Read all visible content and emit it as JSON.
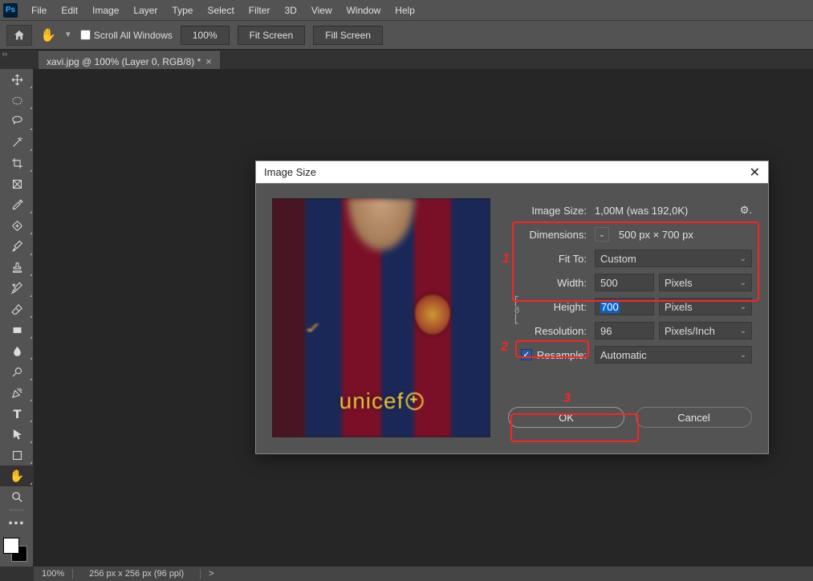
{
  "menubar": [
    "File",
    "Edit",
    "Image",
    "Layer",
    "Type",
    "Select",
    "Filter",
    "3D",
    "View",
    "Window",
    "Help"
  ],
  "optbar": {
    "scroll_all": "Scroll All Windows",
    "zoom": "100%",
    "fit": "Fit Screen",
    "fill": "Fill Screen"
  },
  "tab": {
    "label": "xavi.jpg @ 100% (Layer 0, RGB/8) *"
  },
  "dialog": {
    "title": "Image Size",
    "image_size_lbl": "Image Size:",
    "image_size_val": "1,00M (was 192,0K)",
    "dimensions_lbl": "Dimensions:",
    "dimensions_val": "500 px  ×  700 px",
    "fitto_lbl": "Fit To:",
    "fitto_val": "Custom",
    "width_lbl": "Width:",
    "width_val": "500",
    "width_unit": "Pixels",
    "height_lbl": "Height:",
    "height_val": "700",
    "height_unit": "Pixels",
    "res_lbl": "Resolution:",
    "res_val": "96",
    "res_unit": "Pixels/Inch",
    "resample_lbl": "Resample:",
    "resample_val": "Automatic",
    "ok": "OK",
    "cancel": "Cancel",
    "sponsor": "unicef"
  },
  "annotations": {
    "a1": "1",
    "a2": "2",
    "a3": "3"
  },
  "status": {
    "zoom": "100%",
    "info": "256 px x 256 px (96 ppi)",
    "arrow": ">"
  }
}
